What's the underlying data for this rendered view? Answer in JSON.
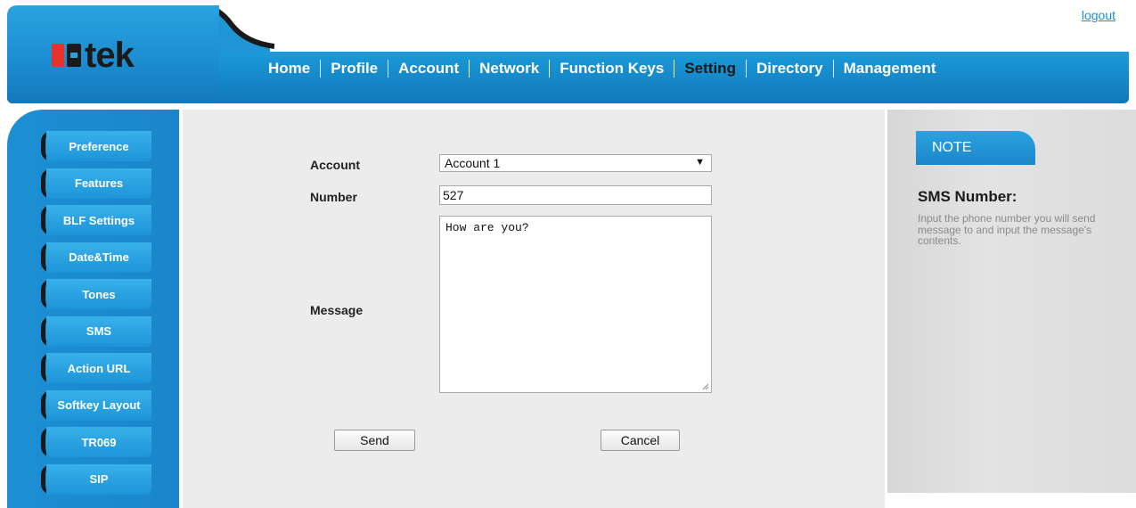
{
  "header": {
    "logout_label": "logout",
    "logo_text": "tek",
    "nav": [
      {
        "label": "Home"
      },
      {
        "label": "Profile"
      },
      {
        "label": "Account"
      },
      {
        "label": "Network"
      },
      {
        "label": "Function Keys"
      },
      {
        "label": "Setting",
        "active": true
      },
      {
        "label": "Directory"
      },
      {
        "label": "Management"
      }
    ]
  },
  "sidebar": {
    "items": [
      {
        "label": "Preference"
      },
      {
        "label": "Features"
      },
      {
        "label": "BLF Settings"
      },
      {
        "label": "Date&Time"
      },
      {
        "label": "Tones"
      },
      {
        "label": "SMS",
        "active": true
      },
      {
        "label": "Action URL"
      },
      {
        "label": "Softkey Layout"
      },
      {
        "label": "TR069"
      },
      {
        "label": "SIP"
      }
    ]
  },
  "form": {
    "account_label": "Account",
    "account_value": "Account 1",
    "number_label": "Number",
    "number_value": "527",
    "message_label": "Message",
    "message_value": "How are you?",
    "send_label": "Send",
    "cancel_label": "Cancel"
  },
  "note": {
    "badge": "NOTE",
    "title": "SMS Number:",
    "body": "Input the phone number you will send message to and input the message's contents."
  },
  "colors": {
    "brand_blue": "#1b8cd0",
    "logo_red": "#e5322b",
    "active_nav": "#1a1a1a",
    "link": "#1e8fcf"
  }
}
